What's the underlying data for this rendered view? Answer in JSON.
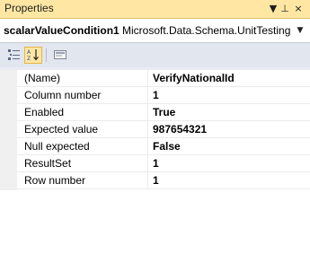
{
  "window": {
    "title": "Properties",
    "dropdown_glyph": "▼",
    "pin_glyph": "⊥",
    "close_glyph": "×"
  },
  "selector": {
    "object_name": "scalarValueCondition1",
    "object_type": "Microsoft.Data.Schema.UnitTesting",
    "arrow_glyph": "▼"
  },
  "toolbar": {
    "categorized_icon": "categorized-icon",
    "alphabetical_icon": "alphabetical-icon",
    "property_pages_icon": "property-pages-icon"
  },
  "properties": [
    {
      "name": "(Name)",
      "value": "VerifyNationalId"
    },
    {
      "name": "Column number",
      "value": "1"
    },
    {
      "name": "Enabled",
      "value": "True"
    },
    {
      "name": "Expected value",
      "value": "987654321"
    },
    {
      "name": "Null expected",
      "value": "False"
    },
    {
      "name": "ResultSet",
      "value": "1"
    },
    {
      "name": "Row number",
      "value": "1"
    }
  ],
  "colors": {
    "titlebar": "#ffe7a3",
    "toolbar": "#e2e6ef",
    "grid_background": "#ffffff"
  }
}
